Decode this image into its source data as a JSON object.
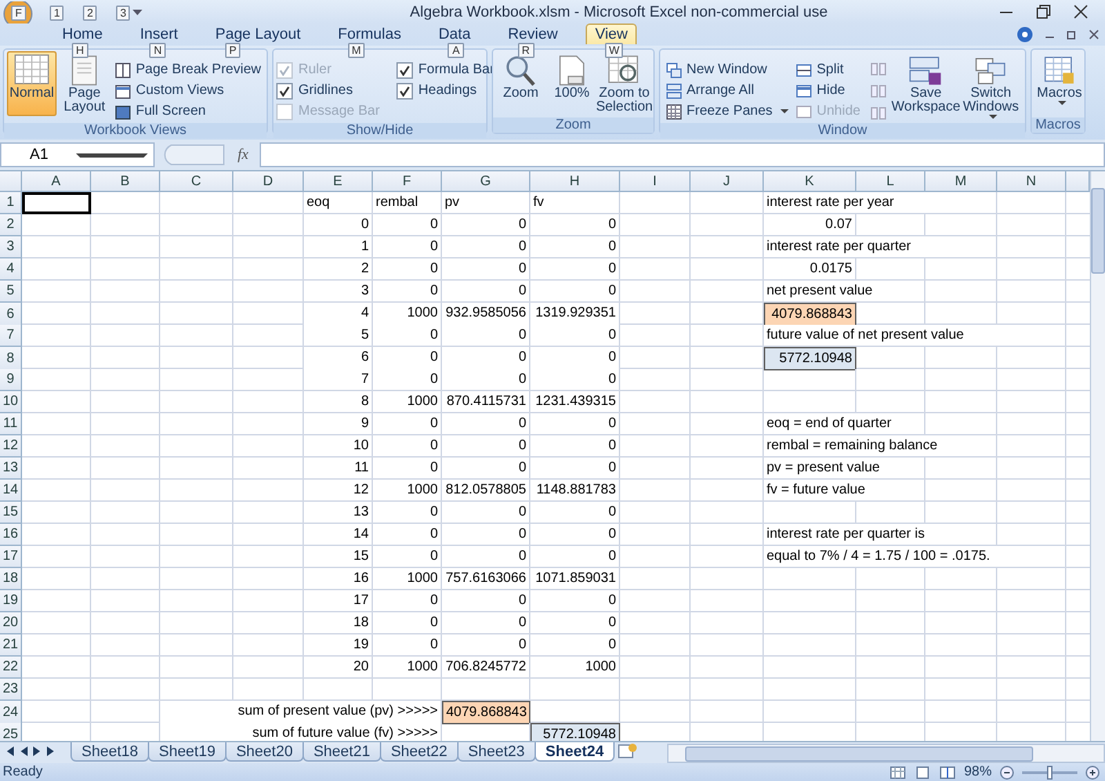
{
  "window": {
    "title": "Algebra Workbook.xlsm - Microsoft Excel non-commercial use",
    "office_button_keytip": "F"
  },
  "quick_access": {
    "keytips": [
      "1",
      "2",
      "3"
    ]
  },
  "ribbon": {
    "tabs": [
      {
        "label": "Home",
        "keytip": "H",
        "selected": false
      },
      {
        "label": "Insert",
        "keytip": "N",
        "selected": false
      },
      {
        "label": "Page Layout",
        "keytip": "P",
        "selected": false
      },
      {
        "label": "Formulas",
        "keytip": "M",
        "selected": false
      },
      {
        "label": "Data",
        "keytip": "A",
        "selected": false
      },
      {
        "label": "Review",
        "keytip": "R",
        "selected": false
      },
      {
        "label": "View",
        "keytip": "W",
        "selected": true
      }
    ],
    "groups": [
      {
        "title": "Workbook Views",
        "kind": "views",
        "large": [
          {
            "label": "Normal",
            "selected": true
          },
          {
            "label": "Page Layout",
            "selected": false
          }
        ],
        "small": [
          "Page Break Preview",
          "Custom Views",
          "Full Screen"
        ]
      },
      {
        "title": "Show/Hide",
        "kind": "checks",
        "checks": [
          {
            "label": "Ruler",
            "checked": true,
            "disabled": true
          },
          {
            "label": "Gridlines",
            "checked": true,
            "disabled": false
          },
          {
            "label": "Message Bar",
            "checked": false,
            "disabled": true
          },
          {
            "label": "Formula Bar",
            "checked": true,
            "disabled": false
          },
          {
            "label": "Headings",
            "checked": true,
            "disabled": false
          }
        ]
      },
      {
        "title": "Zoom",
        "kind": "large",
        "buttons": [
          {
            "label": "Zoom",
            "dropdown": false
          },
          {
            "label": "100%",
            "dropdown": false
          },
          {
            "label": "Zoom to Selection",
            "dropdown": false
          }
        ]
      },
      {
        "title": "Window",
        "kind": "window",
        "small": [
          {
            "label": "New Window",
            "disabled": false,
            "dropdown": false
          },
          {
            "label": "Arrange All",
            "disabled": false,
            "dropdown": false
          },
          {
            "label": "Freeze Panes",
            "disabled": false,
            "dropdown": true
          },
          {
            "label": "Split",
            "disabled": false,
            "dropdown": false
          },
          {
            "label": "Hide",
            "disabled": false,
            "dropdown": false
          },
          {
            "label": "Unhide",
            "disabled": true,
            "dropdown": false
          }
        ],
        "large": [
          {
            "label": "Save Workspace",
            "dropdown": false
          },
          {
            "label": "Switch Windows",
            "dropdown": true
          }
        ]
      },
      {
        "title": "Macros",
        "kind": "large",
        "buttons": [
          {
            "label": "Macros",
            "dropdown": true
          }
        ]
      }
    ]
  },
  "formula_bar": {
    "name_box": "A1",
    "function_button": "fx"
  },
  "sheet": {
    "columns": [
      "A",
      "B",
      "C",
      "D",
      "E",
      "F",
      "G",
      "H",
      "I",
      "J",
      "K",
      "L",
      "M",
      "N"
    ],
    "rows": [
      {
        "number": "1",
        "cells": [
          {
            "kind": "active"
          },
          {
            "kind": "blank"
          },
          {
            "kind": "blank"
          },
          {
            "kind": "blank"
          },
          {
            "kind": "text",
            "text": "eoq"
          },
          {
            "kind": "text",
            "text": "rembal"
          },
          {
            "kind": "text",
            "text": "pv"
          },
          {
            "kind": "text",
            "text": "fv"
          },
          {
            "kind": "blank"
          },
          {
            "kind": "blank"
          },
          {
            "kind": "text",
            "text": "interest rate per year"
          }
        ]
      },
      {
        "number": "2",
        "cells": [
          {
            "kind": "blank"
          },
          {
            "kind": "blank"
          },
          {
            "kind": "blank"
          },
          {
            "kind": "blank"
          },
          {
            "kind": "number",
            "text": "0"
          },
          {
            "kind": "number",
            "text": "0"
          },
          {
            "kind": "number",
            "text": "0"
          },
          {
            "kind": "number",
            "text": "0"
          },
          {
            "kind": "blank"
          },
          {
            "kind": "blank"
          },
          {
            "kind": "number",
            "text": "0.07"
          }
        ]
      },
      {
        "number": "3",
        "cells": [
          {
            "kind": "blank"
          },
          {
            "kind": "blank"
          },
          {
            "kind": "blank"
          },
          {
            "kind": "blank"
          },
          {
            "kind": "number",
            "text": "1"
          },
          {
            "kind": "number",
            "text": "0"
          },
          {
            "kind": "number",
            "text": "0"
          },
          {
            "kind": "number",
            "text": "0"
          },
          {
            "kind": "blank"
          },
          {
            "kind": "blank"
          },
          {
            "kind": "text",
            "text": "interest rate per quarter"
          }
        ]
      },
      {
        "number": "4",
        "cells": [
          {
            "kind": "blank"
          },
          {
            "kind": "blank"
          },
          {
            "kind": "blank"
          },
          {
            "kind": "blank"
          },
          {
            "kind": "number",
            "text": "2"
          },
          {
            "kind": "number",
            "text": "0"
          },
          {
            "kind": "number",
            "text": "0"
          },
          {
            "kind": "number",
            "text": "0"
          },
          {
            "kind": "blank"
          },
          {
            "kind": "blank"
          },
          {
            "kind": "number",
            "text": "0.0175"
          }
        ]
      },
      {
        "number": "5",
        "cells": [
          {
            "kind": "blank"
          },
          {
            "kind": "blank"
          },
          {
            "kind": "blank"
          },
          {
            "kind": "blank"
          },
          {
            "kind": "number",
            "text": "3"
          },
          {
            "kind": "number",
            "text": "0"
          },
          {
            "kind": "number",
            "text": "0"
          },
          {
            "kind": "number",
            "text": "0"
          },
          {
            "kind": "blank"
          },
          {
            "kind": "blank"
          },
          {
            "kind": "text",
            "text": "net present value"
          }
        ]
      },
      {
        "number": "6",
        "cells": [
          {
            "kind": "blank"
          },
          {
            "kind": "blank"
          },
          {
            "kind": "blank"
          },
          {
            "kind": "blank"
          },
          {
            "kind": "number",
            "text": "4"
          },
          {
            "kind": "number",
            "text": "1000"
          },
          {
            "kind": "number",
            "text": "932.9585056"
          },
          {
            "kind": "number",
            "text": "1319.929351"
          },
          {
            "kind": "blank"
          },
          {
            "kind": "blank"
          },
          {
            "kind": "number",
            "text": "4079.868843",
            "color": "#fcd5b4"
          }
        ]
      },
      {
        "number": "7",
        "cells": [
          {
            "kind": "blank"
          },
          {
            "kind": "blank"
          },
          {
            "kind": "blank"
          },
          {
            "kind": "blank"
          },
          {
            "kind": "number",
            "text": "5"
          },
          {
            "kind": "number",
            "text": "0"
          },
          {
            "kind": "number",
            "text": "0"
          },
          {
            "kind": "number",
            "text": "0"
          },
          {
            "kind": "blank"
          },
          {
            "kind": "blank"
          },
          {
            "kind": "text",
            "text": "future value of net present value"
          }
        ]
      },
      {
        "number": "8",
        "cells": [
          {
            "kind": "blank"
          },
          {
            "kind": "blank"
          },
          {
            "kind": "blank"
          },
          {
            "kind": "blank"
          },
          {
            "kind": "number",
            "text": "6"
          },
          {
            "kind": "number",
            "text": "0"
          },
          {
            "kind": "number",
            "text": "0"
          },
          {
            "kind": "number",
            "text": "0"
          },
          {
            "kind": "blank"
          },
          {
            "kind": "blank"
          },
          {
            "kind": "number",
            "text": "5772.10948",
            "color": "#dce6f1"
          }
        ]
      },
      {
        "number": "9",
        "cells": [
          {
            "kind": "blank"
          },
          {
            "kind": "blank"
          },
          {
            "kind": "blank"
          },
          {
            "kind": "blank"
          },
          {
            "kind": "number",
            "text": "7"
          },
          {
            "kind": "number",
            "text": "0"
          },
          {
            "kind": "number",
            "text": "0"
          },
          {
            "kind": "number",
            "text": "0"
          }
        ]
      },
      {
        "number": "10",
        "cells": [
          {
            "kind": "blank"
          },
          {
            "kind": "blank"
          },
          {
            "kind": "blank"
          },
          {
            "kind": "blank"
          },
          {
            "kind": "number",
            "text": "8"
          },
          {
            "kind": "number",
            "text": "1000"
          },
          {
            "kind": "number",
            "text": "870.4115731"
          },
          {
            "kind": "number",
            "text": "1231.439315"
          }
        ]
      },
      {
        "number": "11",
        "cells": [
          {
            "kind": "blank"
          },
          {
            "kind": "blank"
          },
          {
            "kind": "blank"
          },
          {
            "kind": "blank"
          },
          {
            "kind": "number",
            "text": "9"
          },
          {
            "kind": "number",
            "text": "0"
          },
          {
            "kind": "number",
            "text": "0"
          },
          {
            "kind": "number",
            "text": "0"
          },
          {
            "kind": "blank"
          },
          {
            "kind": "blank"
          },
          {
            "kind": "text",
            "text": "eoq = end of quarter"
          }
        ]
      },
      {
        "number": "12",
        "cells": [
          {
            "kind": "blank"
          },
          {
            "kind": "blank"
          },
          {
            "kind": "blank"
          },
          {
            "kind": "blank"
          },
          {
            "kind": "number",
            "text": "10"
          },
          {
            "kind": "number",
            "text": "0"
          },
          {
            "kind": "number",
            "text": "0"
          },
          {
            "kind": "number",
            "text": "0"
          },
          {
            "kind": "blank"
          },
          {
            "kind": "blank"
          },
          {
            "kind": "text",
            "text": "rembal = remaining balance"
          }
        ]
      },
      {
        "number": "13",
        "cells": [
          {
            "kind": "blank"
          },
          {
            "kind": "blank"
          },
          {
            "kind": "blank"
          },
          {
            "kind": "blank"
          },
          {
            "kind": "number",
            "text": "11"
          },
          {
            "kind": "number",
            "text": "0"
          },
          {
            "kind": "number",
            "text": "0"
          },
          {
            "kind": "number",
            "text": "0"
          },
          {
            "kind": "blank"
          },
          {
            "kind": "blank"
          },
          {
            "kind": "text",
            "text": "pv = present value"
          }
        ]
      },
      {
        "number": "14",
        "cells": [
          {
            "kind": "blank"
          },
          {
            "kind": "blank"
          },
          {
            "kind": "blank"
          },
          {
            "kind": "blank"
          },
          {
            "kind": "number",
            "text": "12"
          },
          {
            "kind": "number",
            "text": "1000"
          },
          {
            "kind": "number",
            "text": "812.0578805"
          },
          {
            "kind": "number",
            "text": "1148.881783"
          },
          {
            "kind": "blank"
          },
          {
            "kind": "blank"
          },
          {
            "kind": "text",
            "text": "fv = future value"
          }
        ]
      },
      {
        "number": "15",
        "cells": [
          {
            "kind": "blank"
          },
          {
            "kind": "blank"
          },
          {
            "kind": "blank"
          },
          {
            "kind": "blank"
          },
          {
            "kind": "number",
            "text": "13"
          },
          {
            "kind": "number",
            "text": "0"
          },
          {
            "kind": "number",
            "text": "0"
          },
          {
            "kind": "number",
            "text": "0"
          }
        ]
      },
      {
        "number": "16",
        "cells": [
          {
            "kind": "blank"
          },
          {
            "kind": "blank"
          },
          {
            "kind": "blank"
          },
          {
            "kind": "blank"
          },
          {
            "kind": "number",
            "text": "14"
          },
          {
            "kind": "number",
            "text": "0"
          },
          {
            "kind": "number",
            "text": "0"
          },
          {
            "kind": "number",
            "text": "0"
          },
          {
            "kind": "blank"
          },
          {
            "kind": "blank"
          },
          {
            "kind": "text",
            "text": "interest rate per quarter is"
          }
        ]
      },
      {
        "number": "17",
        "cells": [
          {
            "kind": "blank"
          },
          {
            "kind": "blank"
          },
          {
            "kind": "blank"
          },
          {
            "kind": "blank"
          },
          {
            "kind": "number",
            "text": "15"
          },
          {
            "kind": "number",
            "text": "0"
          },
          {
            "kind": "number",
            "text": "0"
          },
          {
            "kind": "number",
            "text": "0"
          },
          {
            "kind": "blank"
          },
          {
            "kind": "blank"
          },
          {
            "kind": "text",
            "text": "equal to 7% / 4 = 1.75 / 100 = .0175."
          }
        ]
      },
      {
        "number": "18",
        "cells": [
          {
            "kind": "blank"
          },
          {
            "kind": "blank"
          },
          {
            "kind": "blank"
          },
          {
            "kind": "blank"
          },
          {
            "kind": "number",
            "text": "16"
          },
          {
            "kind": "number",
            "text": "1000"
          },
          {
            "kind": "number",
            "text": "757.6163066"
          },
          {
            "kind": "number",
            "text": "1071.859031"
          }
        ]
      },
      {
        "number": "19",
        "cells": [
          {
            "kind": "blank"
          },
          {
            "kind": "blank"
          },
          {
            "kind": "blank"
          },
          {
            "kind": "blank"
          },
          {
            "kind": "number",
            "text": "17"
          },
          {
            "kind": "number",
            "text": "0"
          },
          {
            "kind": "number",
            "text": "0"
          },
          {
            "kind": "number",
            "text": "0"
          }
        ]
      },
      {
        "number": "20",
        "cells": [
          {
            "kind": "blank"
          },
          {
            "kind": "blank"
          },
          {
            "kind": "blank"
          },
          {
            "kind": "blank"
          },
          {
            "kind": "number",
            "text": "18"
          },
          {
            "kind": "number",
            "text": "0"
          },
          {
            "kind": "number",
            "text": "0"
          },
          {
            "kind": "number",
            "text": "0"
          }
        ]
      },
      {
        "number": "21",
        "cells": [
          {
            "kind": "blank"
          },
          {
            "kind": "blank"
          },
          {
            "kind": "blank"
          },
          {
            "kind": "blank"
          },
          {
            "kind": "number",
            "text": "19"
          },
          {
            "kind": "number",
            "text": "0"
          },
          {
            "kind": "number",
            "text": "0"
          },
          {
            "kind": "number",
            "text": "0"
          }
        ]
      },
      {
        "number": "22",
        "cells": [
          {
            "kind": "blank"
          },
          {
            "kind": "blank"
          },
          {
            "kind": "blank"
          },
          {
            "kind": "blank"
          },
          {
            "kind": "number",
            "text": "20"
          },
          {
            "kind": "number",
            "text": "1000"
          },
          {
            "kind": "number",
            "text": "706.8245772"
          },
          {
            "kind": "number",
            "text": "1000"
          }
        ]
      },
      {
        "number": "23"
      },
      {
        "number": "24",
        "cells": [
          {
            "kind": "blank"
          },
          {
            "kind": "blank"
          },
          {
            "kind": "blank"
          },
          {
            "kind": "blank"
          },
          {
            "kind": "blank"
          },
          {
            "kind": "label",
            "text": "sum of present value (pv) >>>>>"
          },
          {
            "kind": "number",
            "text": "4079.868843",
            "color": "#fcd5b4"
          }
        ]
      },
      {
        "number": "25",
        "cells": [
          {
            "kind": "blank"
          },
          {
            "kind": "blank"
          },
          {
            "kind": "blank"
          },
          {
            "kind": "blank"
          },
          {
            "kind": "blank"
          },
          {
            "kind": "label",
            "text": "sum of future value (fv) >>>>>"
          },
          {
            "kind": "blank"
          },
          {
            "kind": "number",
            "text": "5772.10948",
            "color": "#dce6f1"
          }
        ]
      }
    ]
  },
  "sheet_tabs": [
    {
      "label": "Sheet18",
      "selected": false
    },
    {
      "label": "Sheet19",
      "selected": false
    },
    {
      "label": "Sheet20",
      "selected": false
    },
    {
      "label": "Sheet21",
      "selected": false
    },
    {
      "label": "Sheet22",
      "selected": false
    },
    {
      "label": "Sheet23",
      "selected": false
    },
    {
      "label": "Sheet24",
      "selected": true
    }
  ],
  "status_bar": {
    "text": "Ready",
    "zoom": "98%",
    "zoom_slider": {
      "level": 0.5
    }
  }
}
